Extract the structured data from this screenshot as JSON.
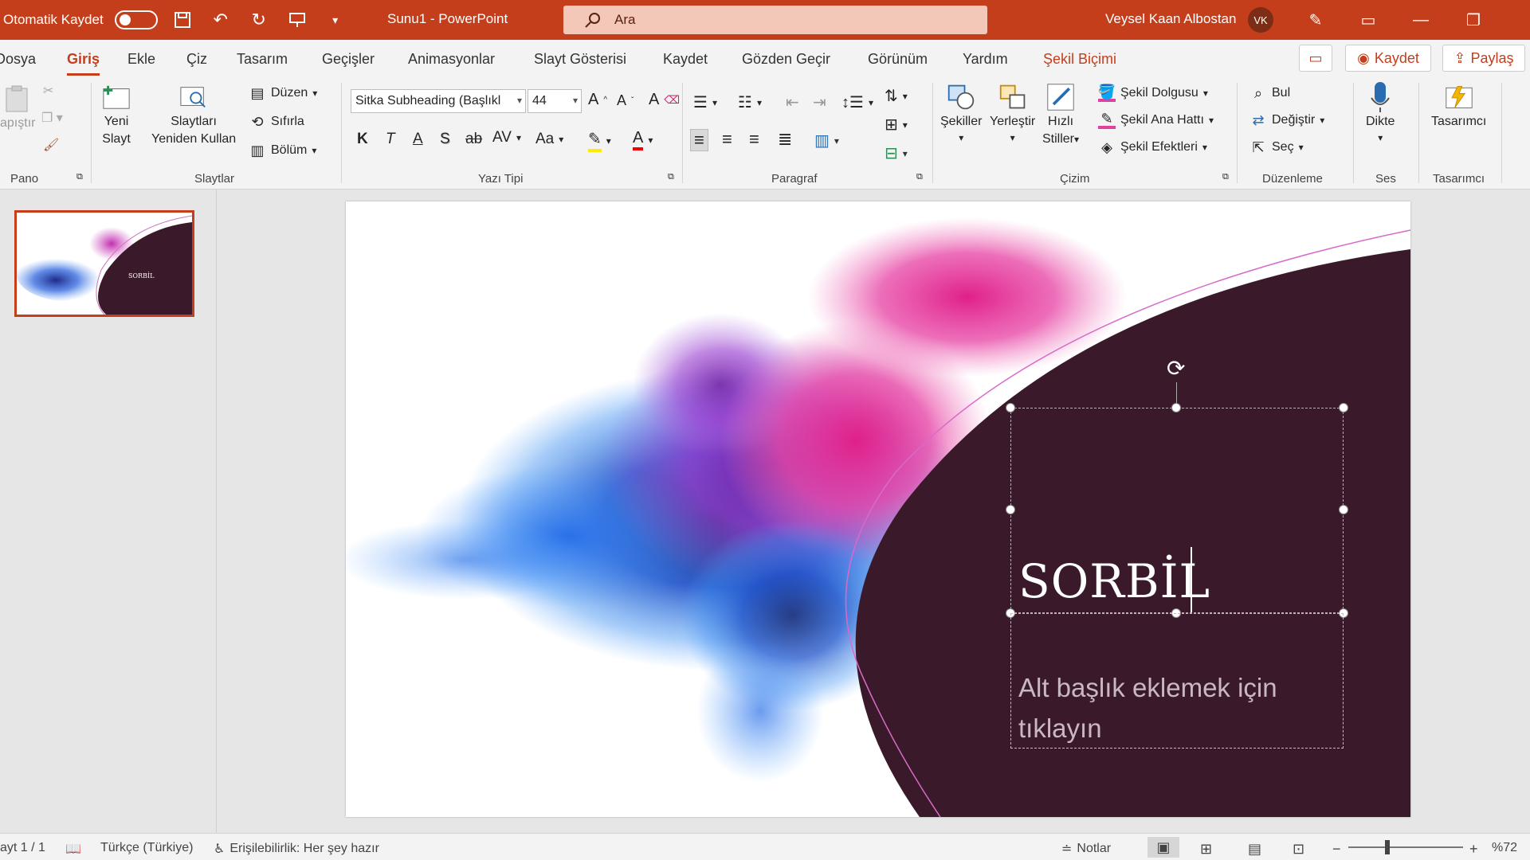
{
  "titlebar": {
    "autosave_label": "Otomatik Kaydet",
    "doc_title": "Sunu1  -  PowerPoint",
    "search_placeholder": "Ara",
    "user_name": "Veysel Kaan Albostan",
    "user_initials": "VK"
  },
  "menu": {
    "tabs": [
      "Dosya",
      "Giriş",
      "Ekle",
      "Çiz",
      "Tasarım",
      "Geçişler",
      "Animasyonlar",
      "Slayt Gösterisi",
      "Kaydet",
      "Gözden Geçir",
      "Görünüm",
      "Yardım",
      "Şekil Biçimi"
    ],
    "record_label": "Kaydet",
    "share_label": "Paylaş"
  },
  "ribbon": {
    "pano": {
      "label": "Pano",
      "paste": "apıştır"
    },
    "slaytlar": {
      "label": "Slaytlar",
      "new_slide_1": "Yeni",
      "new_slide_2": "Slayt",
      "reuse_1": "Slaytları",
      "reuse_2": "Yeniden Kullan",
      "layout": "Düzen",
      "reset": "Sıfırla",
      "section": "Bölüm"
    },
    "yazi_tipi": {
      "label": "Yazı Tipi",
      "font_name": "Sitka Subheading (Başlıkl",
      "font_size": "44",
      "bold": "K",
      "italic": "T",
      "underline": "A",
      "shadow": "S",
      "strike": "ab",
      "spacing": "AV",
      "case": "Aa"
    },
    "paragraf": {
      "label": "Paragraf"
    },
    "cizim": {
      "label": "Çizim",
      "shapes": "Şekiller",
      "arrange": "Yerleştir",
      "quick_1": "Hızlı",
      "quick_2": "Stiller",
      "fill": "Şekil Dolgusu",
      "outline": "Şekil Ana Hattı",
      "effects": "Şekil Efektleri"
    },
    "duzenleme": {
      "label": "Düzenleme",
      "find": "Bul",
      "replace": "Değiştir",
      "select": "Seç"
    },
    "ses": {
      "label": "Ses",
      "dictate": "Dikte"
    },
    "tasarimci": {
      "label": "Tasarımcı",
      "designer": "Tasarımcı"
    }
  },
  "slide": {
    "title": "SORBİL",
    "subtitle": "Alt başlık eklemek için tıklayın",
    "thumb_title": "SORBİL"
  },
  "status": {
    "slide_count": "ayt 1 / 1",
    "language": "Türkçe (Türkiye)",
    "accessibility": "Erişilebilirlik: Her şey hazır",
    "notes": "Notlar",
    "zoom": "%72"
  },
  "colors": {
    "accent": "#c43e1c",
    "slide_dark": "#3a1a2a"
  }
}
